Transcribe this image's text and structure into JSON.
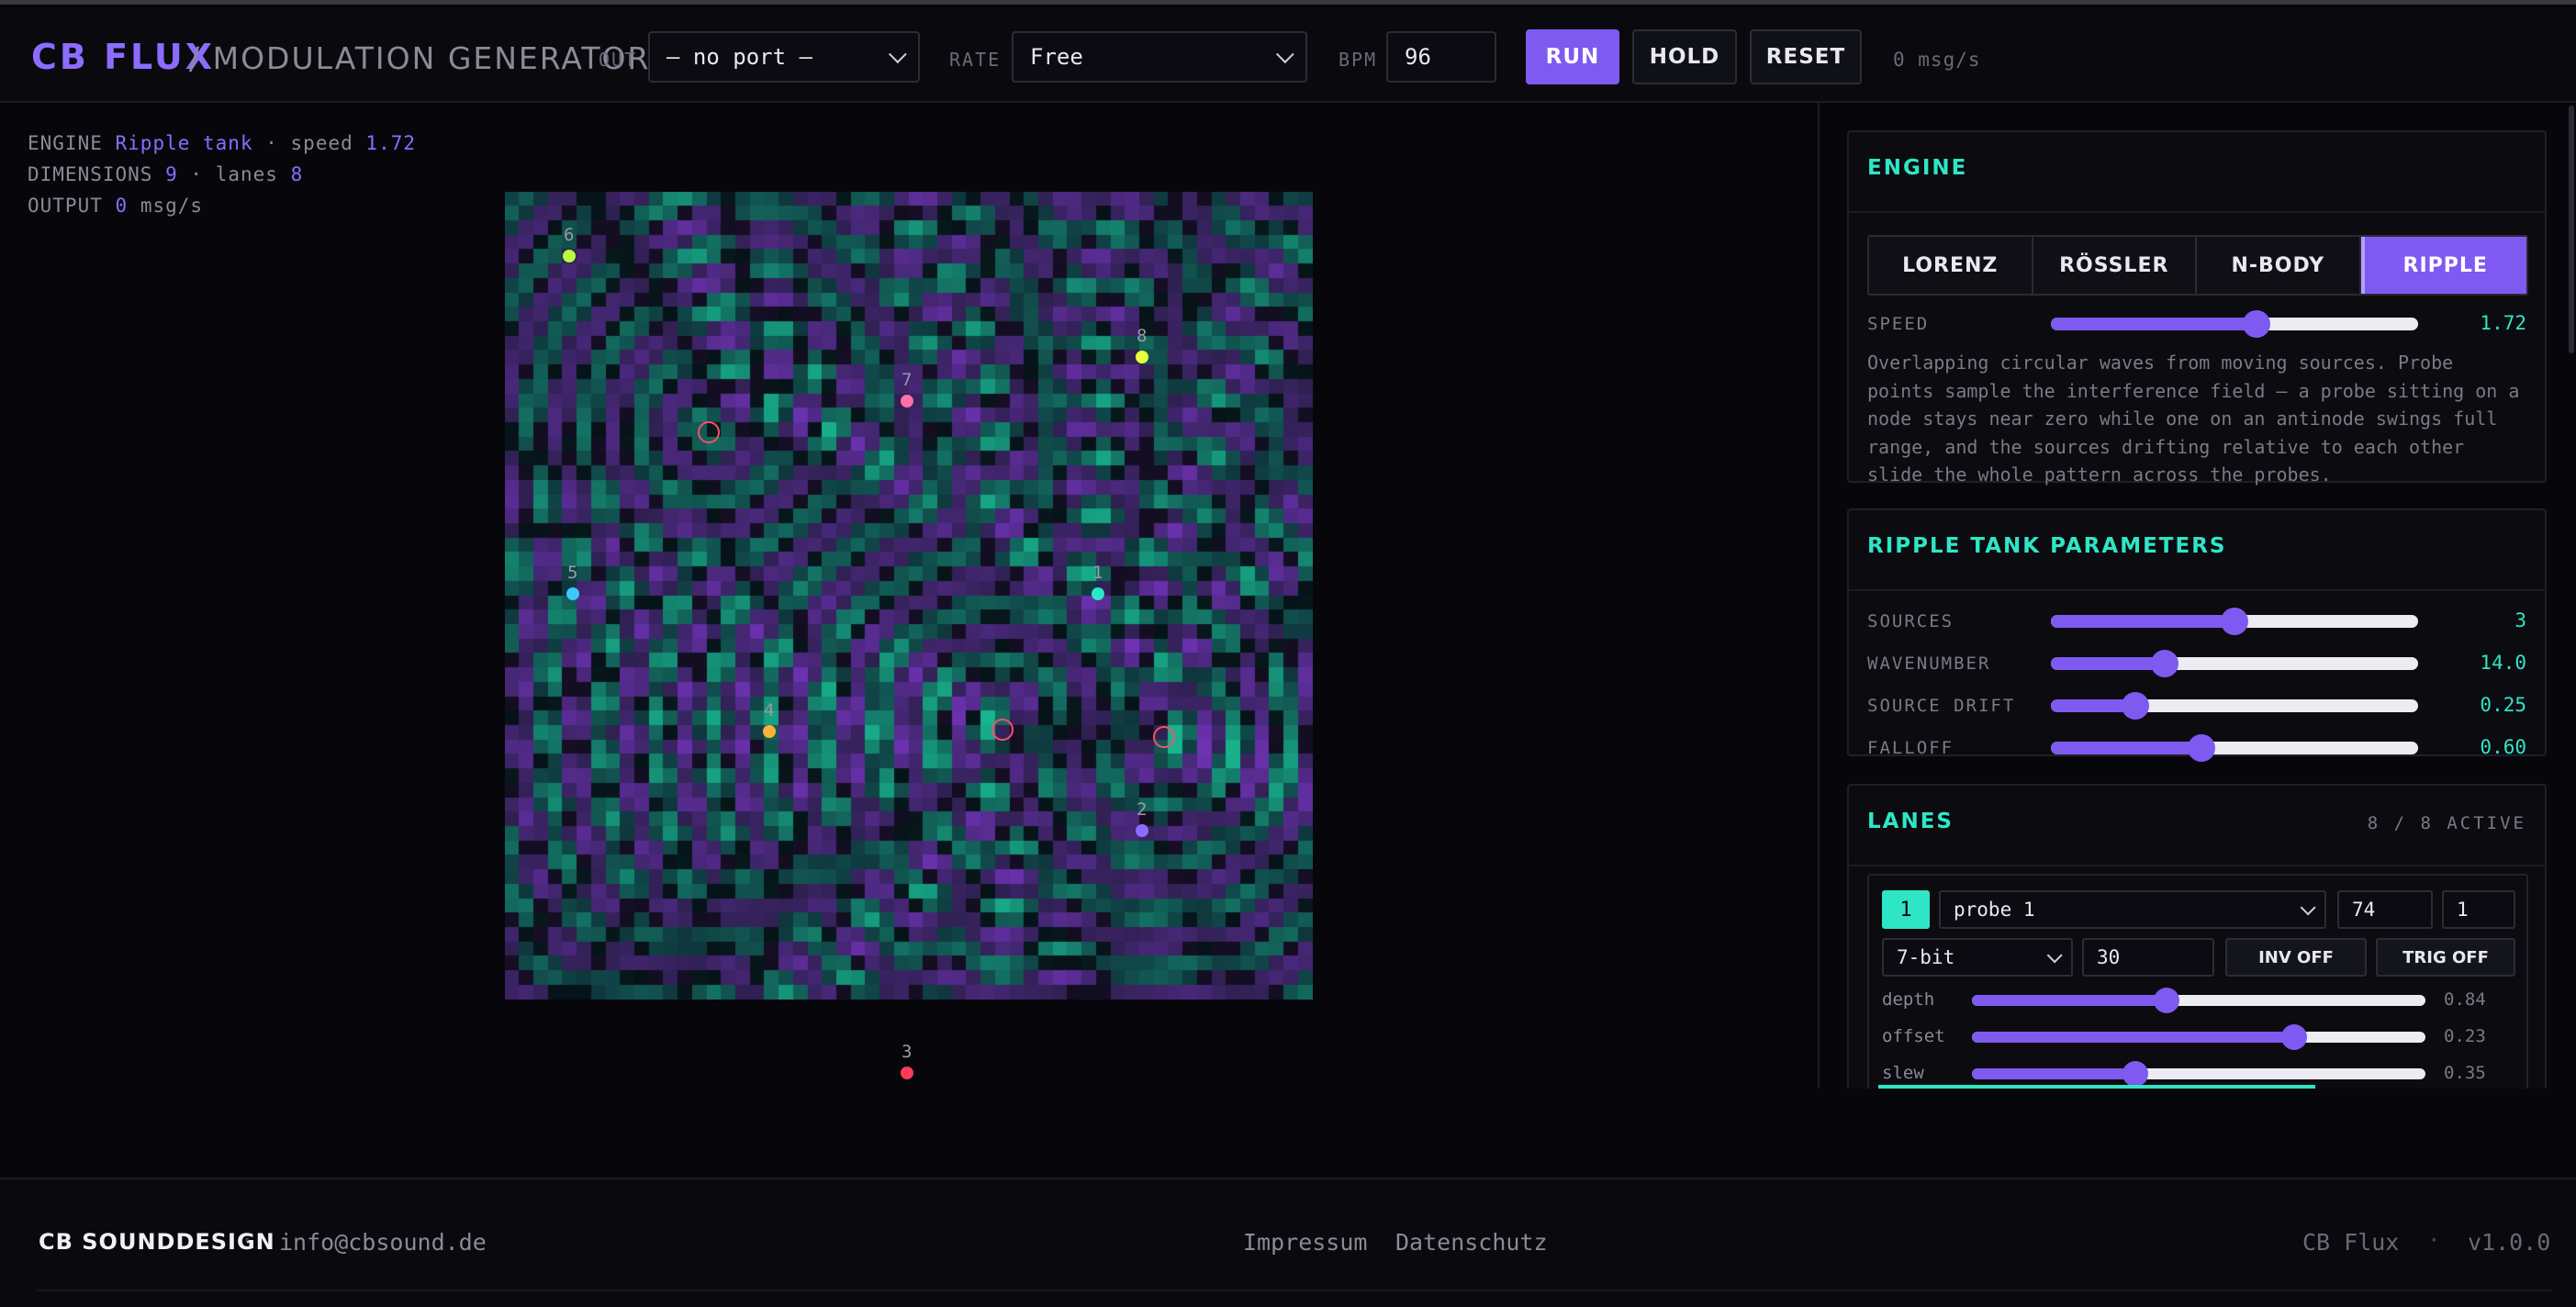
{
  "header": {
    "brand": "CB FLUX",
    "subtitle": "/ MODULATION GENERATOR",
    "out_label": "OUT",
    "out_value": "— no port —",
    "rate_label": "RATE",
    "rate_value": "Free",
    "bpm_label": "BPM",
    "bpm_value": "96",
    "run_label": "RUN",
    "hold_label": "HOLD",
    "reset_label": "RESET",
    "msg_rate": "0 msg/s"
  },
  "stats": {
    "engine_label": "ENGINE",
    "engine_value": "Ripple tank",
    "speed_sep": "· speed",
    "speed_value": "1.72",
    "dimensions_label": "DIMENSIONS",
    "dimensions_value": "9",
    "lanes_sep": "· lanes",
    "lanes_value": "8",
    "output_label": "OUTPUT",
    "output_value": "0",
    "output_unit": "msg/s"
  },
  "probes": [
    {
      "label": "6",
      "color": "#b6ff3b"
    },
    {
      "label": "8",
      "color": "#e8ff3b"
    },
    {
      "label": "7",
      "color": "#ff6fa8"
    },
    {
      "label": "5",
      "color": "#3bc8ff"
    },
    {
      "label": "1",
      "color": "#2ee6c6"
    },
    {
      "label": "4",
      "color": "#ffb23b"
    },
    {
      "label": "2",
      "color": "#8b6cff"
    },
    {
      "label": "3",
      "color": "#ff3b5c"
    }
  ],
  "engine_card": {
    "title": "ENGINE",
    "modes": [
      "LORENZ",
      "RÖSSLER",
      "N-BODY",
      "RIPPLE"
    ],
    "active_mode": "RIPPLE",
    "speed_label": "SPEED",
    "speed_value": "1.72",
    "speed_fraction": 0.56,
    "description": "Overlapping circular waves from moving sources. Probe points sample the interference field — a probe sitting on a node stays near zero while one on an antinode swings full range, and the sources drifting relative to each other slide the whole pattern across the probes."
  },
  "ripple_card": {
    "title": "RIPPLE TANK PARAMETERS",
    "params": [
      {
        "label": "SOURCES",
        "value": "3",
        "fraction": 0.5
      },
      {
        "label": "WAVENUMBER",
        "value": "14.0",
        "fraction": 0.31
      },
      {
        "label": "SOURCE DRIFT",
        "value": "0.25",
        "fraction": 0.23
      },
      {
        "label": "FALLOFF",
        "value": "0.60",
        "fraction": 0.41
      }
    ]
  },
  "lanes_card": {
    "title": "LANES",
    "count": "8 / 8 ACTIVE",
    "lane": {
      "number": "1",
      "source": "probe 1",
      "cc": "74",
      "channel": "1",
      "resolution": "7-bit",
      "rate": "30",
      "inv": "INV OFF",
      "trig": "TRIG OFF",
      "params": [
        {
          "label": "depth",
          "value": "0.84",
          "fraction": 0.43
        },
        {
          "label": "offset",
          "value": "0.23",
          "fraction": 0.71
        },
        {
          "label": "slew",
          "value": "0.35",
          "fraction": 0.36
        }
      ]
    }
  },
  "footer": {
    "brand": "CB SOUNDDESIGN",
    "email": "info@cbsound.de",
    "impressum": "Impressum",
    "datenschutz": "Datenschutz",
    "product": "CB Flux",
    "version": "v1.0.0"
  },
  "colors": {
    "accent": "#7f5af0",
    "teal": "#2ee6c6",
    "source_ring": "#ff4f6a"
  }
}
